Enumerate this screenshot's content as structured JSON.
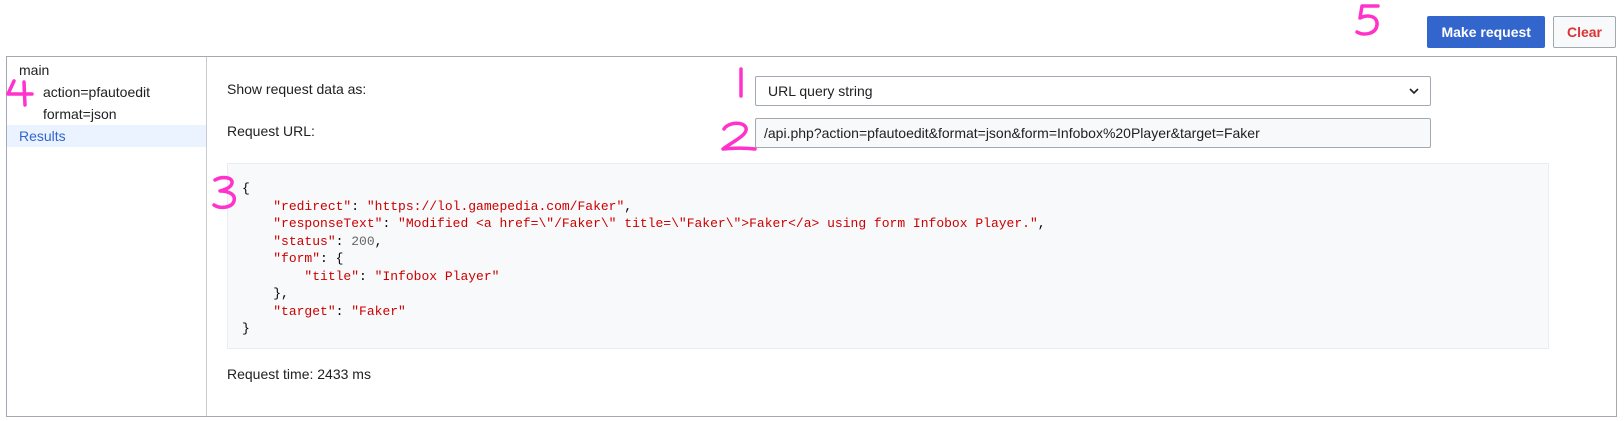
{
  "toolbar": {
    "make_request_label": "Make request",
    "clear_label": "Clear"
  },
  "sidebar": {
    "main_label": "main",
    "params": [
      "action=pfautoedit",
      "format=json"
    ],
    "results_label": "Results"
  },
  "content": {
    "show_label": "Show request data as:",
    "show_selected": "URL query string",
    "url_label": "Request URL:",
    "url_value": "/api.php?action=pfautoedit&format=json&form=Infobox%20Player&target=Faker",
    "request_time": "Request time: 2433 ms"
  },
  "response": {
    "open_brace": "{",
    "close_brace": "}",
    "redirect_key": "\"redirect\"",
    "redirect_value": "\"https://lol.gamepedia.com/Faker\"",
    "responseText_key": "\"responseText\"",
    "responseText_value": "\"Modified <a href=\\\"/Faker\\\" title=\\\"Faker\\\">Faker</a> using form Infobox Player.\"",
    "status_key": "\"status\"",
    "status_value": "200",
    "form_key": "\"form\"",
    "form_open": "{",
    "title_key": "\"title\"",
    "title_value": "\"Infobox Player\"",
    "form_close": "},",
    "target_key": "\"target\"",
    "target_value": "\"Faker\""
  },
  "annotations": {
    "labels": [
      "1",
      "2",
      "3",
      "4",
      "5"
    ],
    "color": "#ff33cc"
  },
  "colors": {
    "primary": "#3366cc",
    "destructive": "#d33",
    "json_string": "#cc0000"
  }
}
